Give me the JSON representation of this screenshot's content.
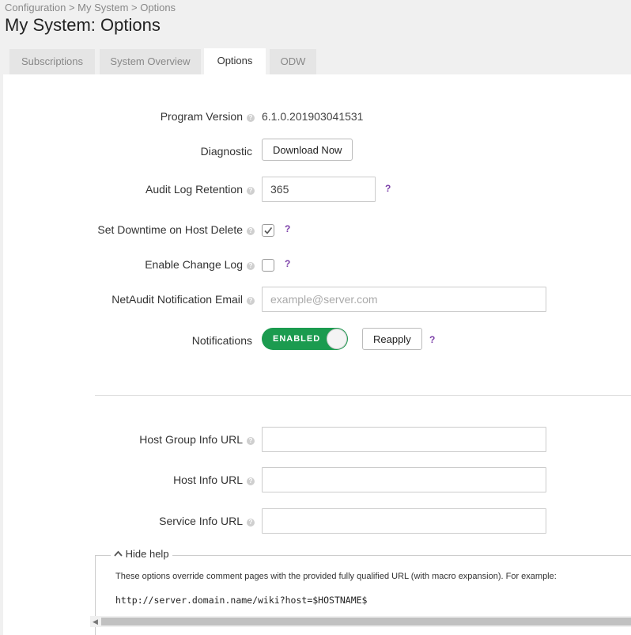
{
  "breadcrumb": "Configuration > My System > Options",
  "page_title": "My System: Options",
  "tabs": [
    {
      "label": "Subscriptions"
    },
    {
      "label": "System Overview"
    },
    {
      "label": "Options"
    },
    {
      "label": "ODW"
    }
  ],
  "active_tab": "Options",
  "rows": {
    "program_version": {
      "label": "Program Version",
      "value": "6.1.0.201903041531"
    },
    "diagnostic": {
      "label": "Diagnostic",
      "button": "Download Now"
    },
    "audit_log": {
      "label": "Audit Log Retention",
      "value": "365"
    },
    "downtime": {
      "label": "Set Downtime on Host Delete",
      "checked": true
    },
    "change_log": {
      "label": "Enable Change Log",
      "checked": false
    },
    "email": {
      "label": "NetAudit Notification Email",
      "placeholder": "example@server.com",
      "value": ""
    },
    "notifications": {
      "label": "Notifications",
      "toggle": "ENABLED",
      "button": "Reapply"
    },
    "host_group_url": {
      "label": "Host Group Info URL",
      "value": ""
    },
    "host_url": {
      "label": "Host Info URL",
      "value": ""
    },
    "service_url": {
      "label": "Service Info URL",
      "value": ""
    }
  },
  "help": {
    "toggle_label": "Hide help",
    "text": "These options override comment pages with the provided fully qualified URL (with macro expansion). For example:",
    "example": "http://server.domain.name/wiki?host=$HOSTNAME$"
  },
  "glyphs": {
    "info": "?",
    "help": "?"
  },
  "colors": {
    "accent_green": "#1b9b4f",
    "help_purple": "#7b3fa8"
  }
}
